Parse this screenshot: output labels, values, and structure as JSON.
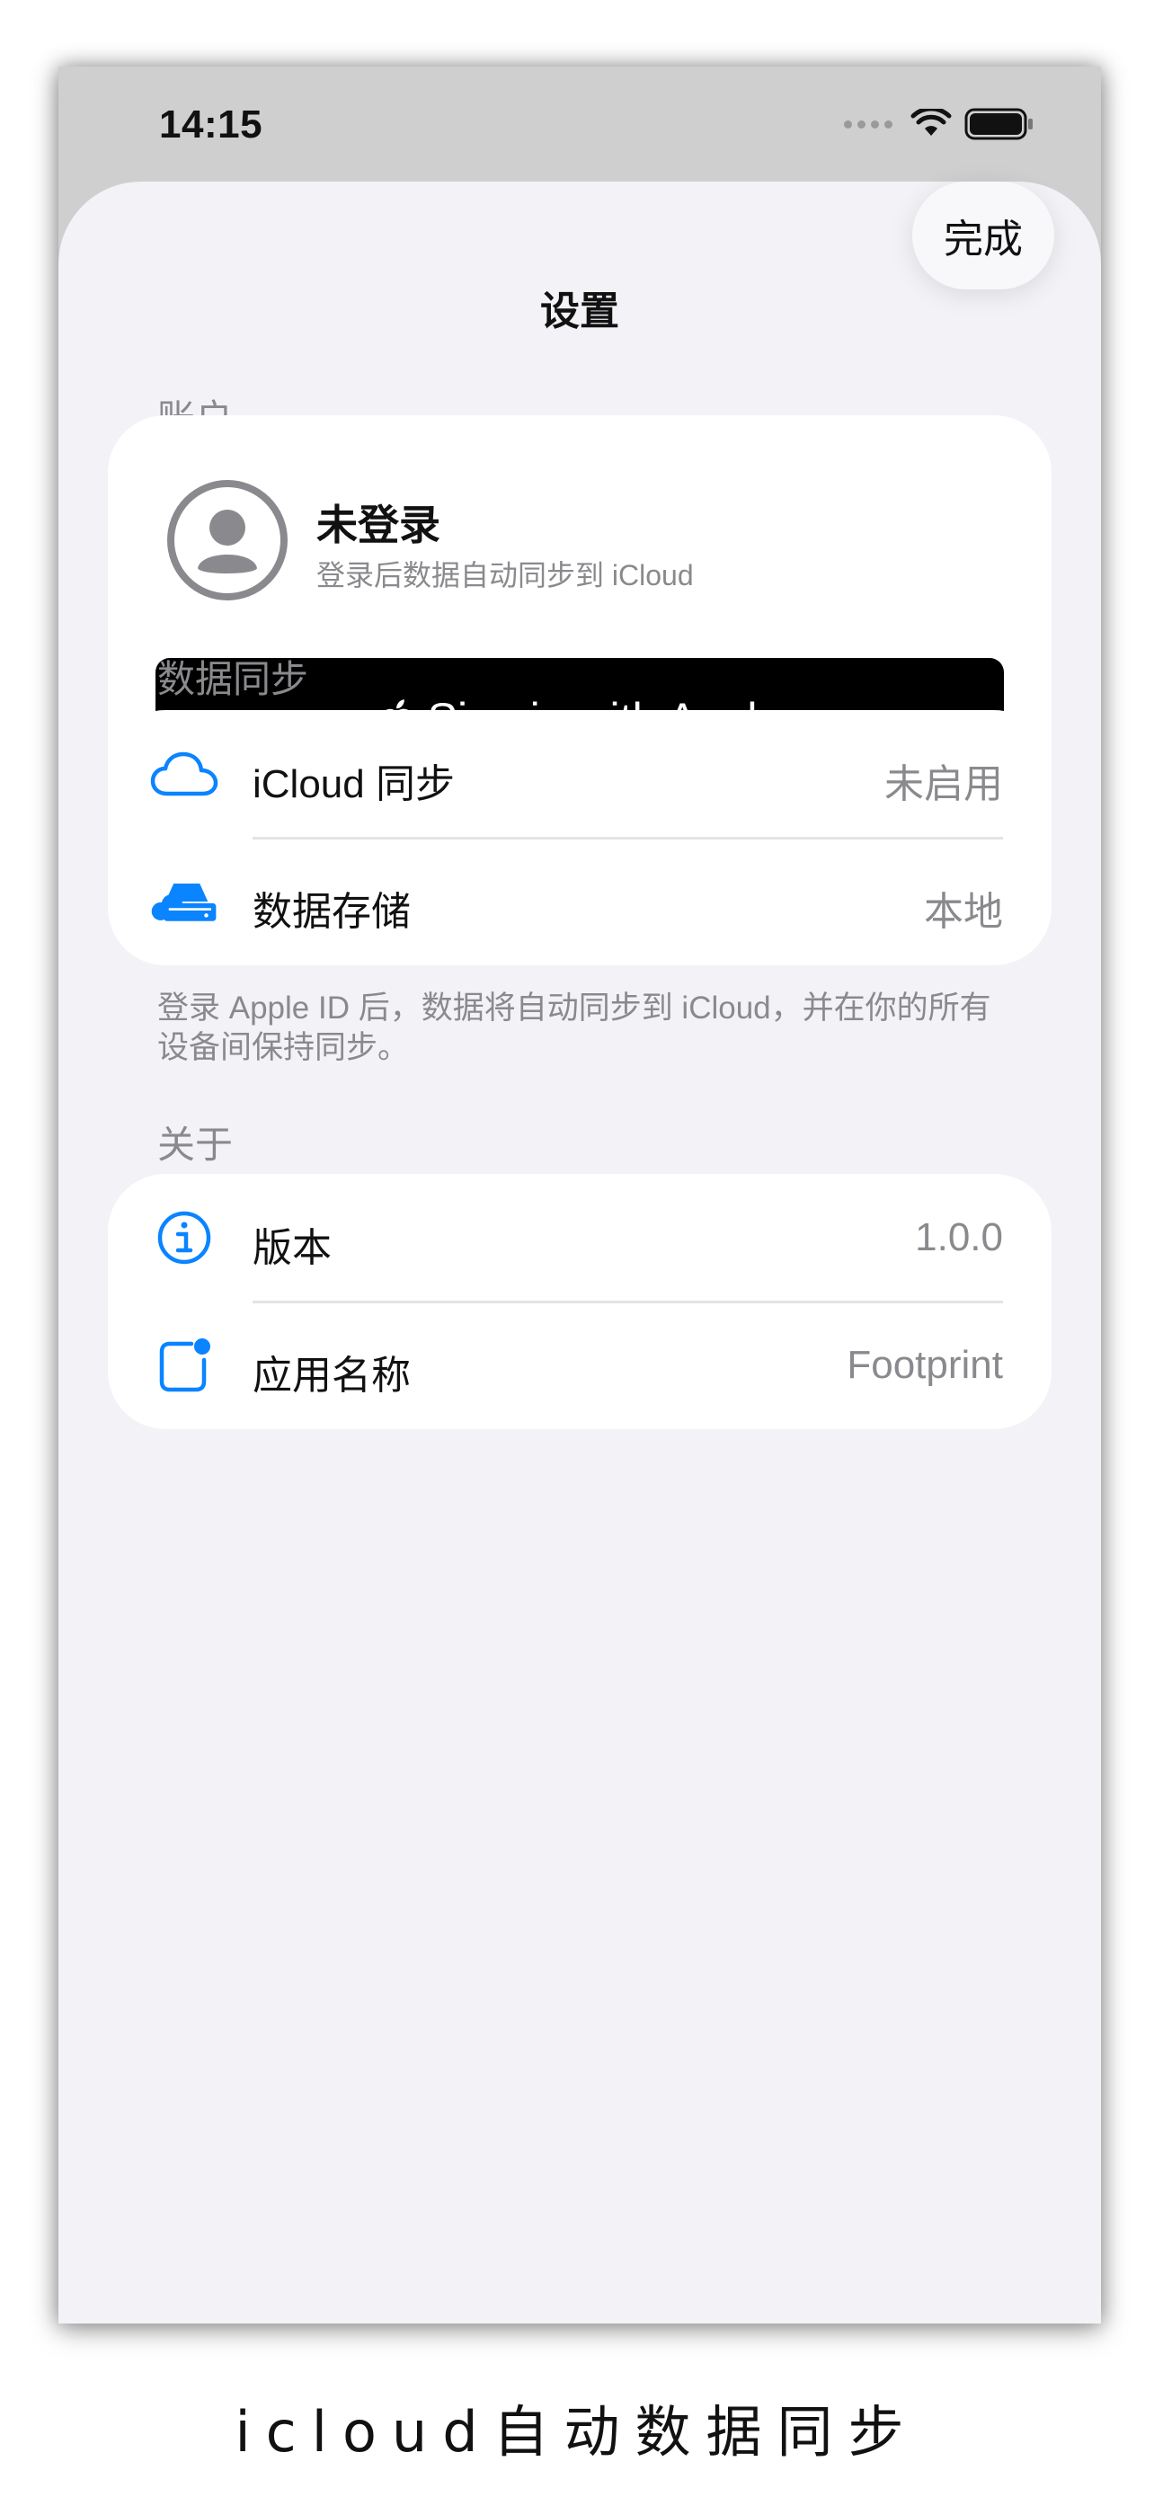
{
  "status_bar": {
    "time": "14:15"
  },
  "nav": {
    "title": "设置",
    "done_label": "完成"
  },
  "account": {
    "section_title": "账户",
    "name": "未登录",
    "subtitle": "登录后数据自动同步到 iCloud",
    "sign_in_label": "Sign in with Apple"
  },
  "sync": {
    "section_title": "数据同步",
    "rows": [
      {
        "icon": "cloud-icon",
        "label": "iCloud 同步",
        "value": "未启用"
      },
      {
        "icon": "storage-drive-icon",
        "label": "数据存储",
        "value": "本地"
      }
    ],
    "footnote": "登录 Apple ID 后，数据将自动同步到 iCloud，并在你的所有设备间保持同步。"
  },
  "about": {
    "section_title": "关于",
    "rows": [
      {
        "icon": "info-icon",
        "label": "版本",
        "value": "1.0.0"
      },
      {
        "icon": "app-badge-icon",
        "label": "应用名称",
        "value": "Footprint"
      }
    ]
  },
  "caption": "icloud自动数据同步",
  "colors": {
    "accent": "#0a84ff",
    "background": "#f2f2f7",
    "secondary_text": "#8a8a8e"
  }
}
